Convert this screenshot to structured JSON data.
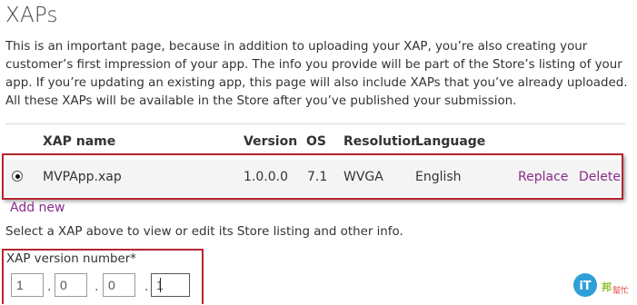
{
  "page": {
    "title": "XAPs",
    "intro": "This is an important page, because in addition to uploading your XAP, you’re also creating your customer’s first impression of your app. The info you provide will be part of the Store’s listing of your app. If you’re updating an existing app, this page will also include XAPs that you’ve already uploaded. All these XAPs will be available in the Store after you’ve published your submission."
  },
  "table": {
    "headers": {
      "name": "XAP name",
      "version": "Version",
      "os": "OS",
      "resolution": "Resolution",
      "language": "Language"
    },
    "rows": [
      {
        "selected": true,
        "name": "MVPApp.xap",
        "version": "1.0.0.0",
        "os": "7.1",
        "resolution": "WVGA",
        "language": "English",
        "replace": "Replace",
        "delete": "Delete"
      }
    ]
  },
  "add_new": "Add new",
  "select_hint": "Select a XAP above to view or edit its Store listing and other info.",
  "version_number": {
    "label": "XAP version number*",
    "separator": ".",
    "parts": [
      "1",
      "0",
      "0",
      "1"
    ]
  },
  "watermark": {
    "text": "iT邦幫忙"
  },
  "colors": {
    "link": "#8a2b8c",
    "highlight_border": "#b3262e",
    "row_background": "#f4f4f4"
  }
}
